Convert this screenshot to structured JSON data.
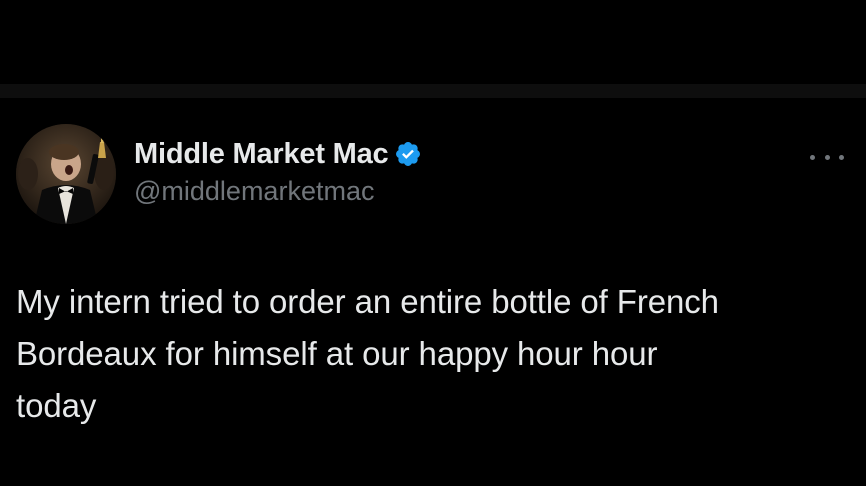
{
  "tweet": {
    "author": {
      "display_name": "Middle Market Mac",
      "handle": "@middlemarketmac",
      "verified": true,
      "verified_color": "#1d9bf0",
      "avatar_icon": "avatar-photo"
    },
    "more_icon": "more-horizontal-icon",
    "text": "My intern tried to order an entire bottle of French\nBordeaux for himself at our happy hour hour\ntoday"
  },
  "colors": {
    "background": "#000000",
    "primary_text": "#e7e9ea",
    "secondary_text": "#71767b",
    "divider": "#0e0e0e"
  }
}
